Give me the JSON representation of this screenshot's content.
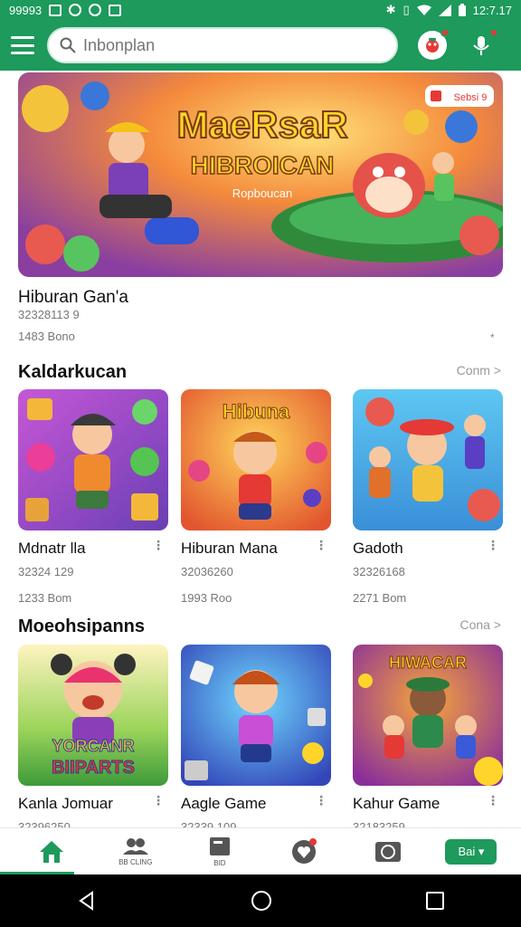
{
  "status": {
    "left_text": "99993",
    "time": "12:7.17"
  },
  "search": {
    "placeholder": "Inbonplan"
  },
  "banner": {
    "title_line1": "MaeRsaR",
    "title_line2": "HIBROICAN",
    "subtitle": "Ropboucan",
    "badge": "Sebsi 9"
  },
  "hero": {
    "title": "Hiburan Gan'a",
    "meta1": "32328113 9",
    "meta2": "1483 Bono",
    "more": "*"
  },
  "sections": [
    {
      "title": "Kaldarkucan",
      "more": "Conm >",
      "cards": [
        {
          "name": "Mdnatr lla",
          "meta1": "32324 129",
          "meta2": "1233 Bom"
        },
        {
          "name": "Hiburan Mana",
          "meta1": "32036260",
          "meta2": "1993 Roo",
          "thumb_title": "Hibuna"
        },
        {
          "name": "Gadoth",
          "meta1": "32326168",
          "meta2": "2271 Bom"
        }
      ]
    },
    {
      "title": "Moeohsipanns",
      "more": "Cona >",
      "cards": [
        {
          "name": "Kanla Jomuar",
          "meta1": "32396250",
          "thumb_title1": "YORCANR",
          "thumb_title2": "BIIPARTS"
        },
        {
          "name": "Aagle Game",
          "meta1": "32339 109"
        },
        {
          "name": "Kahur Game",
          "meta1": "32183259",
          "thumb_title": "HIWACAR"
        }
      ]
    }
  ],
  "bottom_nav": {
    "item2_label": "BB CLING",
    "item3_label": "BID",
    "button": "Bai"
  },
  "colors": {
    "primary": "#1d9a5c",
    "badge_red": "#e53935"
  },
  "icons": [
    "hamburger-menu-icon",
    "search-icon",
    "gift-icon",
    "mic-icon",
    "home-icon",
    "people-icon",
    "file-icon",
    "heart-icon",
    "chat-icon",
    "back-icon",
    "home-circle-icon",
    "recents-icon"
  ]
}
